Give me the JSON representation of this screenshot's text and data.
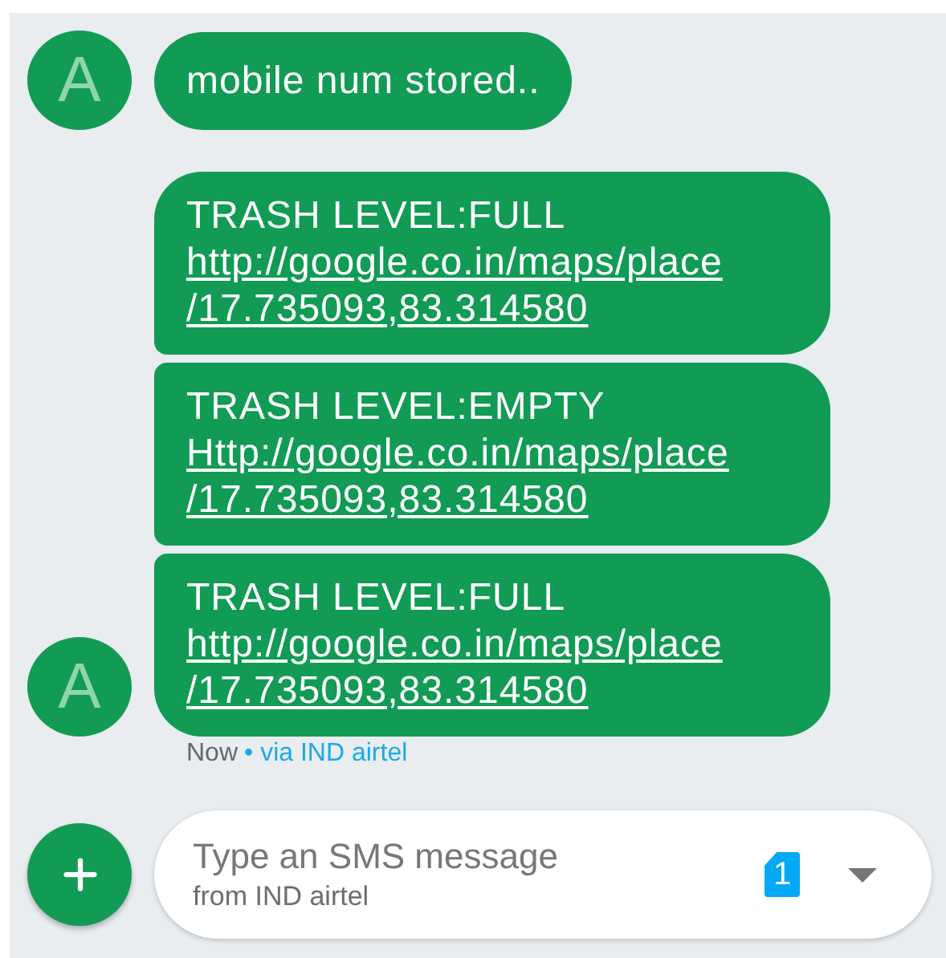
{
  "messages": [
    {
      "avatar": "A",
      "bubbles": [
        {
          "text": "mobile num stored.."
        }
      ]
    },
    {
      "avatar": "A",
      "bubbles": [
        {
          "text": "TRASH LEVEL:FULL",
          "link_lines": [
            "http://google.co.in/maps/place",
            "/17.735093,83.314580"
          ]
        },
        {
          "text": "TRASH LEVEL:EMPTY",
          "link_lines": [
            "Http://google.co.in/maps/place",
            "/17.735093,83.314580"
          ]
        },
        {
          "text": "TRASH LEVEL:FULL",
          "link_lines": [
            "http://google.co.in/maps/place",
            "/17.735093,83.314580"
          ]
        }
      ]
    }
  ],
  "meta": {
    "time": "Now",
    "via": "• via IND airtel"
  },
  "composer": {
    "placeholder": "Type an SMS message",
    "carrier": "from IND airtel",
    "sim": "1"
  }
}
